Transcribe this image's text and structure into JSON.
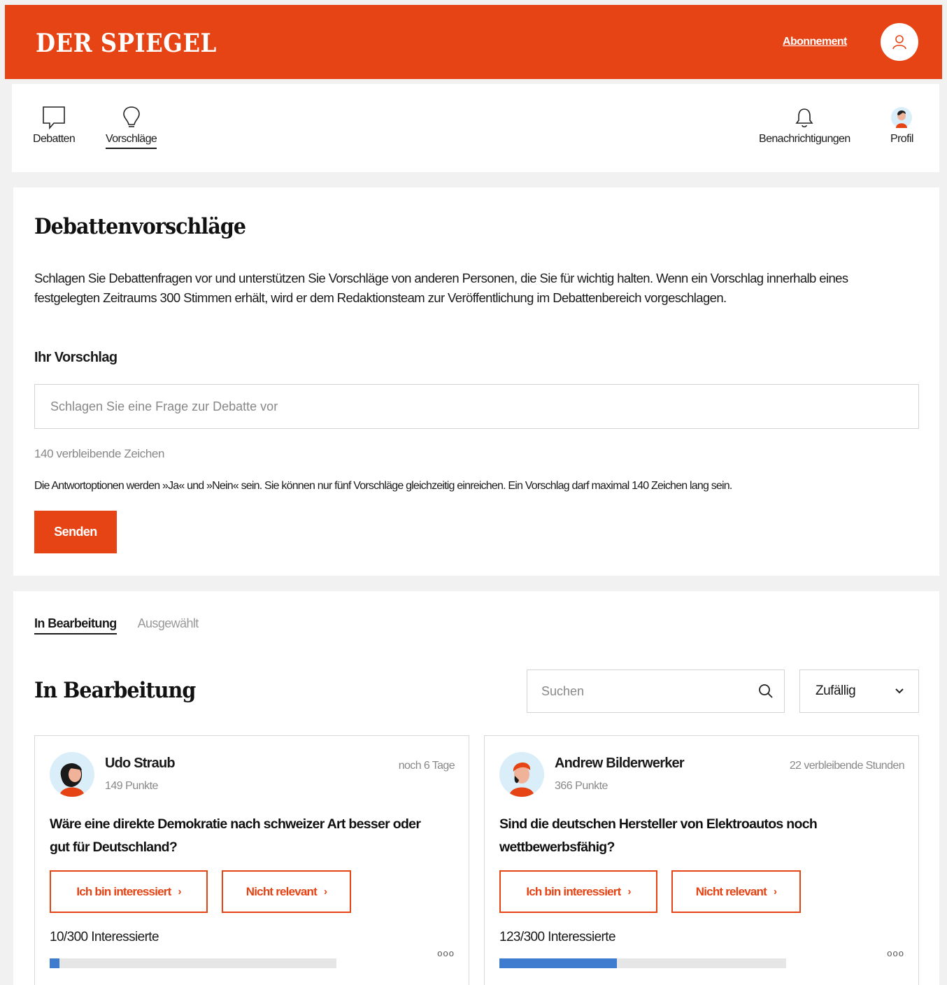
{
  "header": {
    "logo": "DER SPIEGEL",
    "subscription_link": "Abonnement"
  },
  "nav": {
    "debates": "Debatten",
    "suggestions": "Vorschläge",
    "notifications": "Benachrichtigungen",
    "profile": "Profil"
  },
  "suggest": {
    "title": "Debattenvorschläge",
    "intro": "Schlagen Sie Debattenfragen vor und unterstützen Sie Vorschläge von anderen Personen, die Sie für wichtig halten. Wenn ein Vorschlag innerhalb eines festgelegten Zeitraums 300 Stimmen erhält, wird er dem Redaktionsteam zur Veröffentlichung im Debattenbereich vorgeschlagen.",
    "field_label": "Ihr Vorschlag",
    "field_placeholder": "Schlagen Sie eine Frage zur Debatte vor",
    "field_value": "",
    "remaining": "140 verbleibende Zeichen",
    "note": "Die Antwortoptionen werden »Ja« und »Nein« sein. Sie können nur fünf Vorschläge gleichzeitig einreichen. Ein Vorschlag darf maximal 140 Zeichen lang sein.",
    "submit": "Senden"
  },
  "list": {
    "tabs": [
      "In Bearbeitung",
      "Ausgewählt"
    ],
    "title": "In Bearbeitung",
    "search_placeholder": "Suchen",
    "sort_value": "Zufällig",
    "cards": [
      {
        "name": "Udo Straub",
        "points": "149 Punkte",
        "time": "noch 6 Tage",
        "question": "Wäre eine direkte Demokratie nach schweizer Art besser oder gut für Deutschland?",
        "btn_interested": "Ich bin interessiert",
        "btn_irrelevant": "Nicht relevant",
        "count": "10/300 Interessierte",
        "progress": 0.033
      },
      {
        "name": "Andrew Bilderwerker",
        "points": "366 Punkte",
        "time": "22 verbleibende Stunden",
        "question": "Sind die deutschen Hersteller von Elektroautos noch wettbewerbsfähig?",
        "btn_interested": "Ich bin interessiert",
        "btn_irrelevant": "Nicht relevant",
        "count": "123/300 Interessierte",
        "progress": 0.41
      }
    ],
    "more_glyph": "ooo"
  },
  "colors": {
    "brand": "#e64415",
    "progress": "#3f7bcf"
  },
  "icons": [
    "user-icon",
    "chat-bubble-icon",
    "lightbulb-icon",
    "bell-icon",
    "avatar",
    "search-icon",
    "chevron-down-icon",
    "chevron-right-icon",
    "more-icon"
  ]
}
